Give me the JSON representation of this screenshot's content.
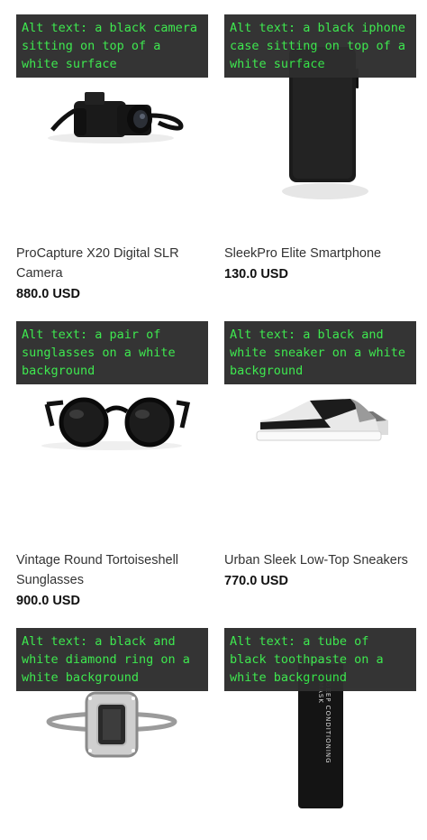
{
  "products": [
    {
      "alt": "Alt text: a black camera sitting on top of a white surface",
      "title": "ProCapture X20 Digital SLR Camera",
      "price": "880.0 USD",
      "icon": "camera-image"
    },
    {
      "alt": "Alt text: a black iphone case sitting on top of a white surface",
      "title": "SleekPro Elite Smartphone",
      "price": "130.0 USD",
      "icon": "smartphone-image"
    },
    {
      "alt": "Alt text: a pair of sunglasses on a white background",
      "title": "Vintage Round Tortoiseshell Sunglasses",
      "price": "900.0 USD",
      "icon": "sunglasses-image"
    },
    {
      "alt": "Alt text: a black and white sneaker on a white background",
      "title": "Urban Sleek Low-Top Sneakers",
      "price": "770.0 USD",
      "icon": "sneaker-image"
    },
    {
      "alt": "Alt text: a black and white diamond ring on a white background",
      "title": "",
      "price": "",
      "icon": "ring-image"
    },
    {
      "alt": "Alt text: a tube of black toothpaste on a white background",
      "title": "",
      "price": "",
      "icon": "toothpaste-image",
      "tube_label": "DEEP CONDITIONING MASK"
    }
  ]
}
